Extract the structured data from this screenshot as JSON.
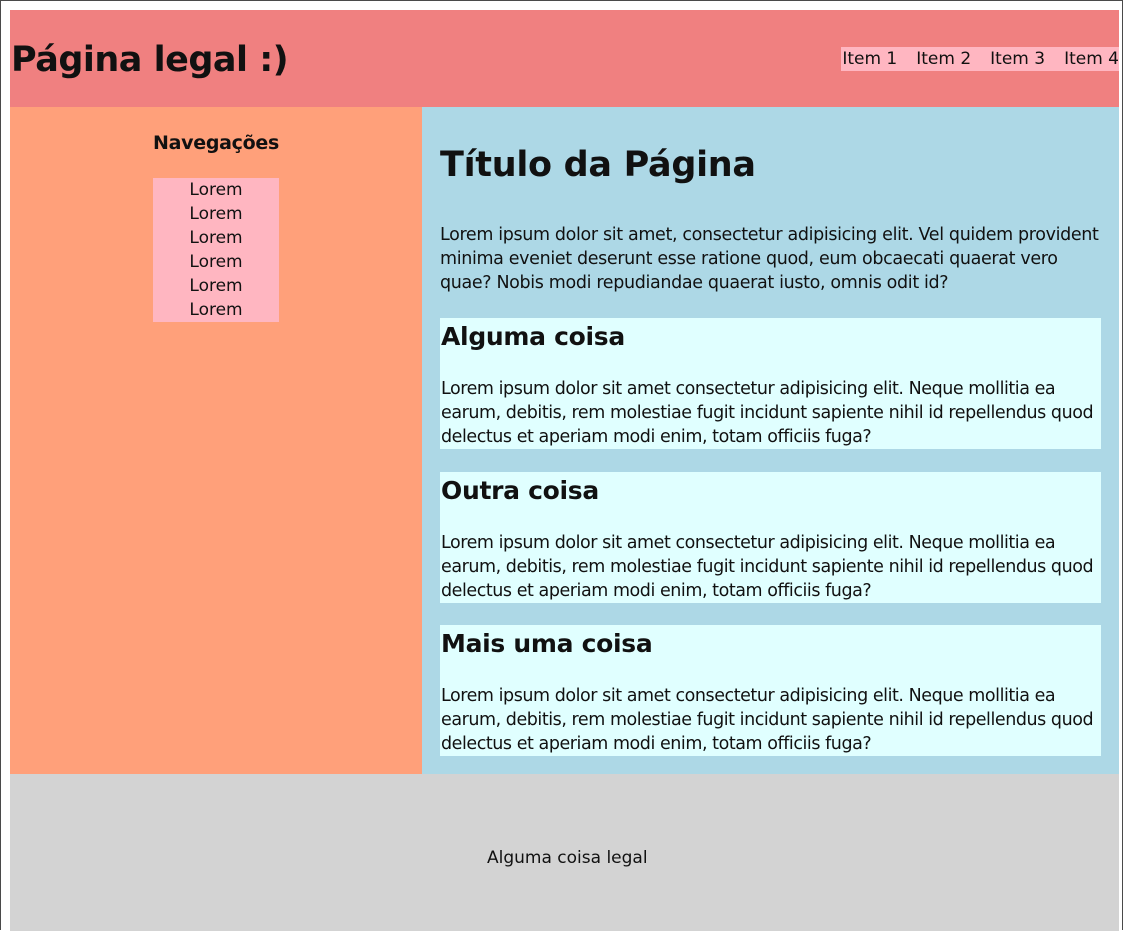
{
  "header": {
    "site_title": "Página legal :)",
    "nav_items": [
      "Item 1",
      "Item 2",
      "Item 3",
      "Item 4"
    ]
  },
  "sidebar": {
    "heading": "Navegações",
    "items": [
      "Lorem",
      "Lorem",
      "Lorem",
      "Lorem",
      "Lorem",
      "Lorem"
    ]
  },
  "main": {
    "title": "Título da Página",
    "intro": "Lorem ipsum dolor sit amet, consectetur adipisicing elit. Vel quidem provident minima eveniet deserunt esse ratione quod, eum obcaecati quaerat vero quae? Nobis modi repudiandae quaerat iusto, omnis odit id?",
    "sections": [
      {
        "heading": "Alguma coisa",
        "text": "Lorem ipsum dolor sit amet consectetur adipisicing elit. Neque mollitia ea earum, debitis, rem molestiae fugit incidunt sapiente nihil id repellendus quod delectus et aperiam modi enim, totam officiis fuga?"
      },
      {
        "heading": "Outra coisa",
        "text": "Lorem ipsum dolor sit amet consectetur adipisicing elit. Neque mollitia ea earum, debitis, rem molestiae fugit incidunt sapiente nihil id repellendus quod delectus et aperiam modi enim, totam officiis fuga?"
      },
      {
        "heading": "Mais uma coisa",
        "text": "Lorem ipsum dolor sit amet consectetur adipisicing elit. Neque mollitia ea earum, debitis, rem molestiae fugit incidunt sapiente nihil id repellendus quod delectus et aperiam modi enim, totam officiis fuga?"
      }
    ]
  },
  "footer": {
    "text": "Alguma coisa legal"
  },
  "colors": {
    "header_bg": "#f08080",
    "nav_bg": "#ffb6c1",
    "sidebar_bg": "#ffa07a",
    "main_bg": "#add8e6",
    "card_bg": "#e0ffff",
    "footer_bg": "#d3d3d3"
  }
}
